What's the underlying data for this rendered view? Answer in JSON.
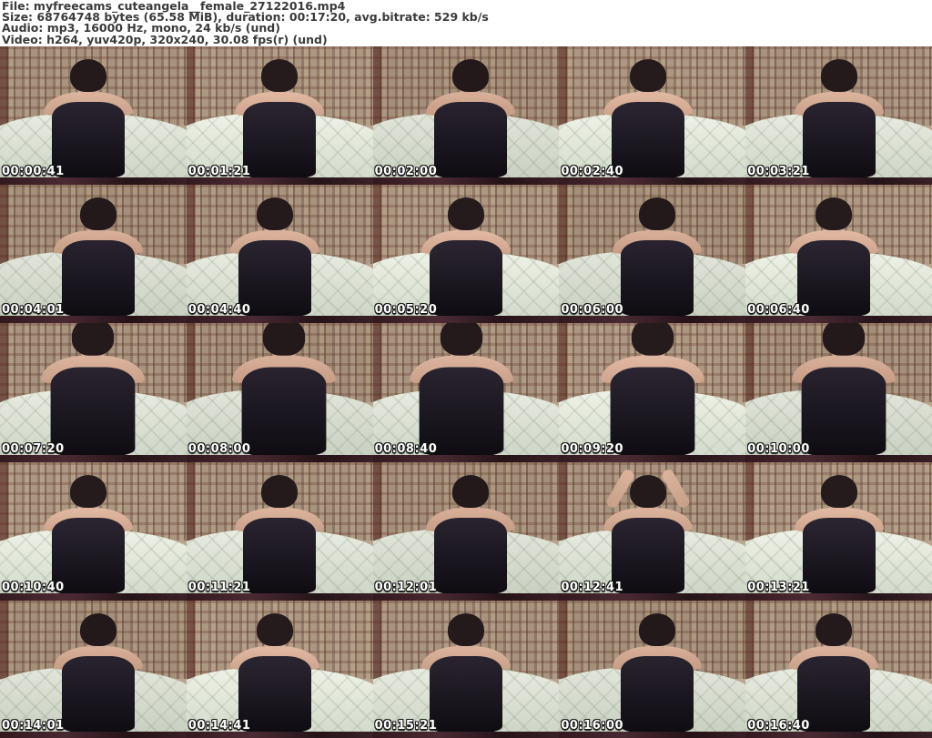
{
  "header": {
    "lines": [
      "File: myfreecams_cuteangela__female_27122016.mp4",
      "Size: 68764748 bytes (65.58 MiB), duration: 00:17:20, avg.bitrate: 529 kb/s",
      "Audio: mp3, 16000 Hz, mono, 24 kb/s (und)",
      "Video: h264, yuv420p, 320x240, 30.08 fps(r) (und)"
    ]
  },
  "grid": {
    "columns": 5,
    "rows": 5,
    "thumbnails": [
      {
        "timestamp": "00:00:41"
      },
      {
        "timestamp": "00:01:21"
      },
      {
        "timestamp": "00:02:00"
      },
      {
        "timestamp": "00:02:40"
      },
      {
        "timestamp": "00:03:21"
      },
      {
        "timestamp": "00:04:01"
      },
      {
        "timestamp": "00:04:40"
      },
      {
        "timestamp": "00:05:20"
      },
      {
        "timestamp": "00:06:00"
      },
      {
        "timestamp": "00:06:40"
      },
      {
        "timestamp": "00:07:20"
      },
      {
        "timestamp": "00:08:00"
      },
      {
        "timestamp": "00:08:40"
      },
      {
        "timestamp": "00:09:20"
      },
      {
        "timestamp": "00:10:00"
      },
      {
        "timestamp": "00:10:40"
      },
      {
        "timestamp": "00:11:21"
      },
      {
        "timestamp": "00:12:01"
      },
      {
        "timestamp": "00:12:41",
        "pose": "arms-up"
      },
      {
        "timestamp": "00:13:21"
      },
      {
        "timestamp": "00:14:01"
      },
      {
        "timestamp": "00:14:41"
      },
      {
        "timestamp": "00:15:21"
      },
      {
        "timestamp": "00:16:00"
      },
      {
        "timestamp": "00:16:40"
      }
    ]
  },
  "colors": {
    "header_text": "#3a3a3a",
    "timestamp_text": "#ffffff",
    "timestamp_outline": "#151515",
    "curtain_base": "#a8937e",
    "bed_base": "#dde1d4",
    "frame_bottom": "#33191f"
  }
}
